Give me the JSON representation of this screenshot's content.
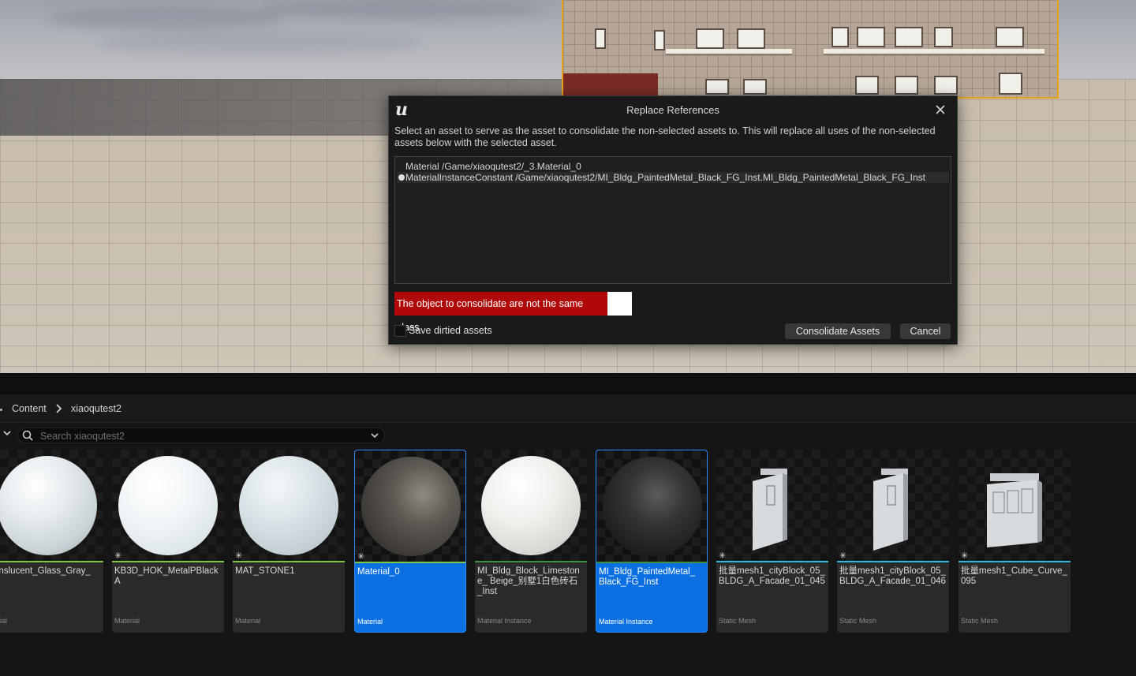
{
  "dialog": {
    "title": "Replace References",
    "description": "Select an asset to serve as the asset to consolidate the non-selected assets to. This will replace all uses of the non-selected assets below with the selected asset.",
    "assets": [
      {
        "label": "Material /Game/xiaoqutest2/_3.Material_0",
        "selected": false
      },
      {
        "label": "MaterialInstanceConstant /Game/xiaoqutest2/MI_Bldg_PaintedMetal_Black_FG_Inst.MI_Bldg_PaintedMetal_Black_FG_Inst",
        "selected": true
      }
    ],
    "error": "The object to consolidate are not the same class",
    "save_dirtied_label": "Save dirtied assets",
    "consolidate_label": "Consolidate Assets",
    "cancel_label": "Cancel"
  },
  "browser": {
    "breadcrumb": [
      "Content",
      "xiaoqutest2"
    ],
    "search_placeholder": "Search xiaoqutest2",
    "assets": [
      {
        "name": "anslucent_Glass_Gray_",
        "type": "erial",
        "kind": "sphere",
        "tone": "white",
        "bar_color": "#7bc846",
        "starred": false,
        "selected": false
      },
      {
        "name": "KB3D_HOK_MetalPBlackA",
        "type": "Material",
        "kind": "sphere",
        "tone": "bright",
        "bar_color": "#7bc846",
        "starred": true,
        "selected": false
      },
      {
        "name": "MAT_STONE1",
        "type": "Material",
        "kind": "sphere",
        "tone": "pale",
        "bar_color": "#7bc846",
        "starred": true,
        "selected": false
      },
      {
        "name": "Material_0",
        "type": "Material",
        "kind": "sphere",
        "tone": "darkgray",
        "bar_color": "#7bc846",
        "starred": true,
        "selected": true
      },
      {
        "name": "MI_Bldg_Block_Limestone_ Beige_别墅1白色砖石_Inst",
        "type": "Material Instance",
        "kind": "sphere",
        "tone": "limestone",
        "bar_color": "#3f8f3f",
        "starred": false,
        "selected": false
      },
      {
        "name": "MI_Bldg_PaintedMetal_ Black_FG_Inst",
        "type": "Material Instance",
        "kind": "sphere",
        "tone": "black",
        "bar_color": "#3f8f3f",
        "starred": false,
        "selected": true
      },
      {
        "name": "批量mesh1_cityBlock_05_ BLDG_A_Facade_01_045",
        "type": "Static Mesh",
        "kind": "mesh",
        "tone": "wall",
        "bar_color": "#33b8d8",
        "starred": true,
        "selected": false
      },
      {
        "name": "批量mesh1_cityBlock_05_ BLDG_A_Facade_01_046",
        "type": "Static Mesh",
        "kind": "mesh",
        "tone": "wall",
        "bar_color": "#33b8d8",
        "starred": true,
        "selected": false
      },
      {
        "name": "批量mesh1_Cube_Curve_ 095",
        "type": "Static Mesh",
        "kind": "mesh",
        "tone": "cube",
        "bar_color": "#33b8d8",
        "starred": true,
        "selected": false
      }
    ]
  },
  "icons": [
    "unreal-logo-icon",
    "close-icon",
    "search-icon",
    "chevron-down-icon",
    "chevron-right-icon",
    "star-icon"
  ]
}
